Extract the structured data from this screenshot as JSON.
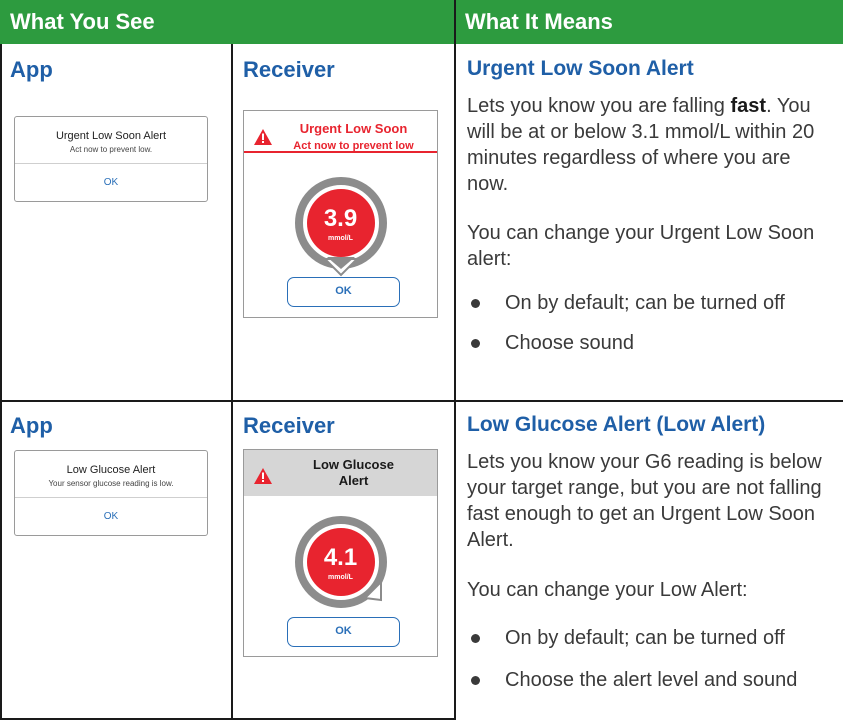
{
  "header": {
    "left": "What You See",
    "right": "What It Means"
  },
  "rows": [
    {
      "app_label": "App",
      "receiver_label": "Receiver",
      "app_dialog": {
        "title": "Urgent Low Soon Alert",
        "subtitle": "Act now to prevent low.",
        "ok": "OK"
      },
      "receiver": {
        "title_line1": "Urgent Low Soon",
        "title_line2": "Act now to prevent low",
        "value": "3.9",
        "unit": "mmol/L",
        "ok": "OK"
      },
      "meaning_title": "Urgent Low Soon Alert",
      "para1_pre": "Lets you know you are falling ",
      "para1_bold": "fast",
      "para1_post": ". You will be at or below 3.1 mmol/L within 20 minutes regardless of where you are now.",
      "para2": "You can change your Urgent Low Soon alert:",
      "bullets": [
        "On by default; can be turned off",
        "Choose sound"
      ]
    },
    {
      "app_label": "App",
      "receiver_label": "Receiver",
      "app_dialog": {
        "title": "Low Glucose Alert",
        "subtitle": "Your sensor glucose reading is low.",
        "ok": "OK"
      },
      "receiver": {
        "title_line1": "Low Glucose",
        "title_line2": "Alert",
        "value": "4.1",
        "unit": "mmol/L",
        "ok": "OK"
      },
      "meaning_title": "Low Glucose Alert (Low Alert)",
      "para1": "Lets you know your G6 reading is below your target range, but you are not falling fast enough to get an Urgent Low Soon Alert.",
      "para2": "You can change your Low Alert:",
      "bullets": [
        "On by default; can be turned off",
        "Choose the alert level and sound"
      ]
    }
  ],
  "colors": {
    "header_green": "#2d9b3f",
    "title_blue": "#1f5fa7",
    "alert_red": "#e8242f"
  },
  "icons": [
    "warning-triangle-icon",
    "glucose-bubble-icon"
  ]
}
